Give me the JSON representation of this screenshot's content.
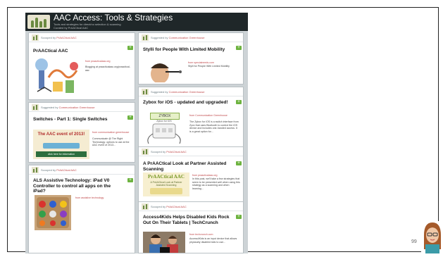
{
  "header": {
    "title": "AAC Access: Tools & Strategies",
    "subtitle_line1": "Tools and strategies for direct/no selection & scanning",
    "subtitle_line2": "Curated by PrAACtical AAC"
  },
  "left_column": [
    {
      "scooped_by": "Scooped by",
      "curator": "PrAACtical AAC",
      "title": "PrAACtical AAC",
      "link": "from praacticalaac.org",
      "desc": "Blogging at praacticalaac.org/praactical-aac"
    },
    {
      "scooped_by": "Suggested by",
      "curator": "Communication Greenhouse",
      "title": "Switches - Part 1: Single Switches",
      "thumb_text": "The AAC event of 2013!",
      "thumb_button": "click here for information",
      "link": "from communication greenhouse",
      "desc": "Communicate @ The Right Technology: options to use at the AAC event of 2013..."
    },
    {
      "scooped_by": "Scooped by",
      "curator": "PrAACtical AAC",
      "title": "ALS Assistive Technology: iPad V0 Controller to control all apps on the iPad?",
      "link": "from assistive technology"
    }
  ],
  "right_column": [
    {
      "scooped_by": "Suggested by",
      "curator": "Communication Greenhouse",
      "title": "Stylli for People With Limited Mobility",
      "link": "from specialneeds.com",
      "desc": "Stylli for People With Limited Mobility"
    },
    {
      "scooped_by": "Suggested by",
      "curator": "Communication Greenhouse",
      "title": "Zybox for iOS - updated and upgraded!",
      "thumb_label": "ZYBOX",
      "thumb_sub": "Zybox for iOS",
      "link": "from Communication Greenhouse",
      "desc": "The Zybox for iOS is a switch interface from Zyxx that uses Bluetooth to control the iOS device and includes one-handed access. It is a great option for..."
    },
    {
      "scooped_by": "Scooped by",
      "curator": "PrAACtical AAC",
      "title": "A PrAACtical Look at Partner Assisted Scanning",
      "thumb_title": "PrAACtical AAC",
      "thumb_sub": "A PrAACtical Look at Partner Assisted Scanning",
      "link": "from praacticalaac.org",
      "desc": "In this post, we'll take a few strategies that seem to be presented well when using this strategy as a scanning and when learning..."
    },
    {
      "scooped_by": "Scooped by",
      "curator": "PrAACtical AAC",
      "title": "Access4Kids Helps Disabled Kids Rock Out On Their Tablets | TechCrunch",
      "link": "from techcrunch.com",
      "desc": "Access4Kids is an input device that allows physically disabled kids to use..."
    }
  ],
  "plus_label": "+",
  "page_number": "99",
  "colors": {
    "header_bg": "#1f2729",
    "page_bg": "#cdd3d6",
    "accent_green": "#6db33f",
    "link_red": "#c0484a"
  }
}
